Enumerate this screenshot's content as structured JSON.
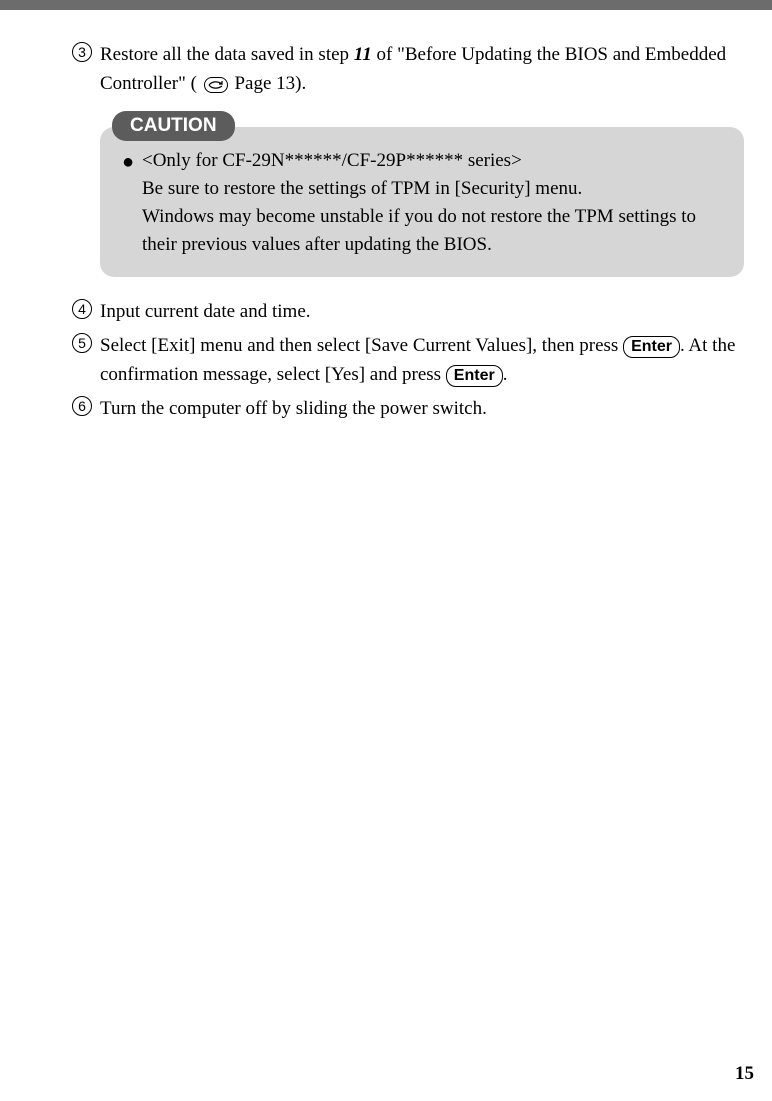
{
  "steps": {
    "s3": {
      "num": "3",
      "text_a": "Restore all the data saved in step ",
      "text_b": "11",
      "text_c": " of \"Before Updating the BIOS and Embedded Controller\" ( ",
      "text_d": " Page 13)."
    },
    "s4": {
      "num": "4",
      "text": "Input current date and time."
    },
    "s5": {
      "num": "5",
      "text_a": "Select [Exit] menu and then select [Save Current Values], then press ",
      "key_a": "Enter",
      "text_b": ". At the confirmation message, select [Yes] and press ",
      "key_b": "Enter",
      "text_c": "."
    },
    "s6": {
      "num": "6",
      "text": "Turn the computer off by sliding the power switch."
    }
  },
  "caution": {
    "label": "CAUTION",
    "line1": "<Only for CF-29N******/CF-29P****** series>",
    "line2": "Be sure to restore the settings of TPM in [Security] menu.",
    "line3": "Windows may become unstable if you do not restore the TPM settings to their previous values after updating the BIOS."
  },
  "page_number": "15"
}
